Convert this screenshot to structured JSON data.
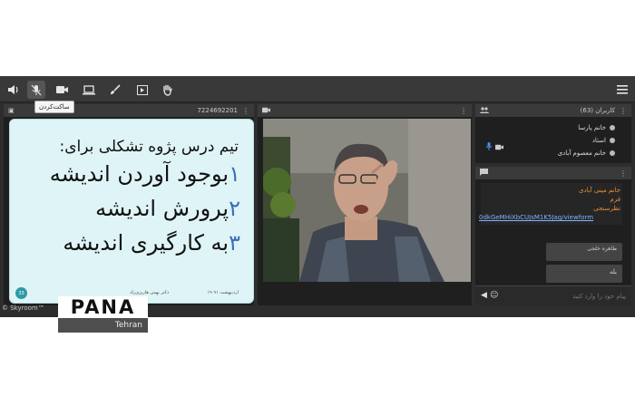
{
  "toolbar": {
    "tooltip": "ساکت‌کردن",
    "buttons": [
      "speaker-icon",
      "mic-muted-icon",
      "camera-icon",
      "screen-share-icon",
      "brush-icon",
      "play-media-icon",
      "raise-hand-icon",
      "menu-icon"
    ]
  },
  "slide_panel": {
    "header_id": "7224692201",
    "title": "تیم درس پژوه تشکلی برای:",
    "items": [
      {
        "num": "۱",
        "text": "بوجود آوردن اندیشه"
      },
      {
        "num": "۲",
        "text": "پرورش اندیشه"
      },
      {
        "num": "۳",
        "text": "به کارگیری اندیشه"
      }
    ],
    "footer_left": "دکتر بهمن هاریزی‌زاد",
    "footer_right": "۱۹ اردیبهشت ۹۱",
    "page_number": "33"
  },
  "users_panel": {
    "title": "کاربران (63)",
    "users": [
      "خانم پارسا",
      "استاد",
      "خانم معصوم آبادی"
    ]
  },
  "chat_panel": {
    "messages": [
      {
        "name": "خانم مینی آبادی",
        "text": "فرم",
        "link_label": "نظرسنجی",
        "link": "0dkGeMHiXbCUJsM1K5Jag/viewform"
      }
    ],
    "reply_name": "طاهره خلجی",
    "reply_text": "بله",
    "input_placeholder": "پیام خود را وارد کنید"
  },
  "footer": {
    "copyright": "© Skyroom™"
  },
  "watermark": {
    "brand": "PANA",
    "city": "Tehran"
  }
}
